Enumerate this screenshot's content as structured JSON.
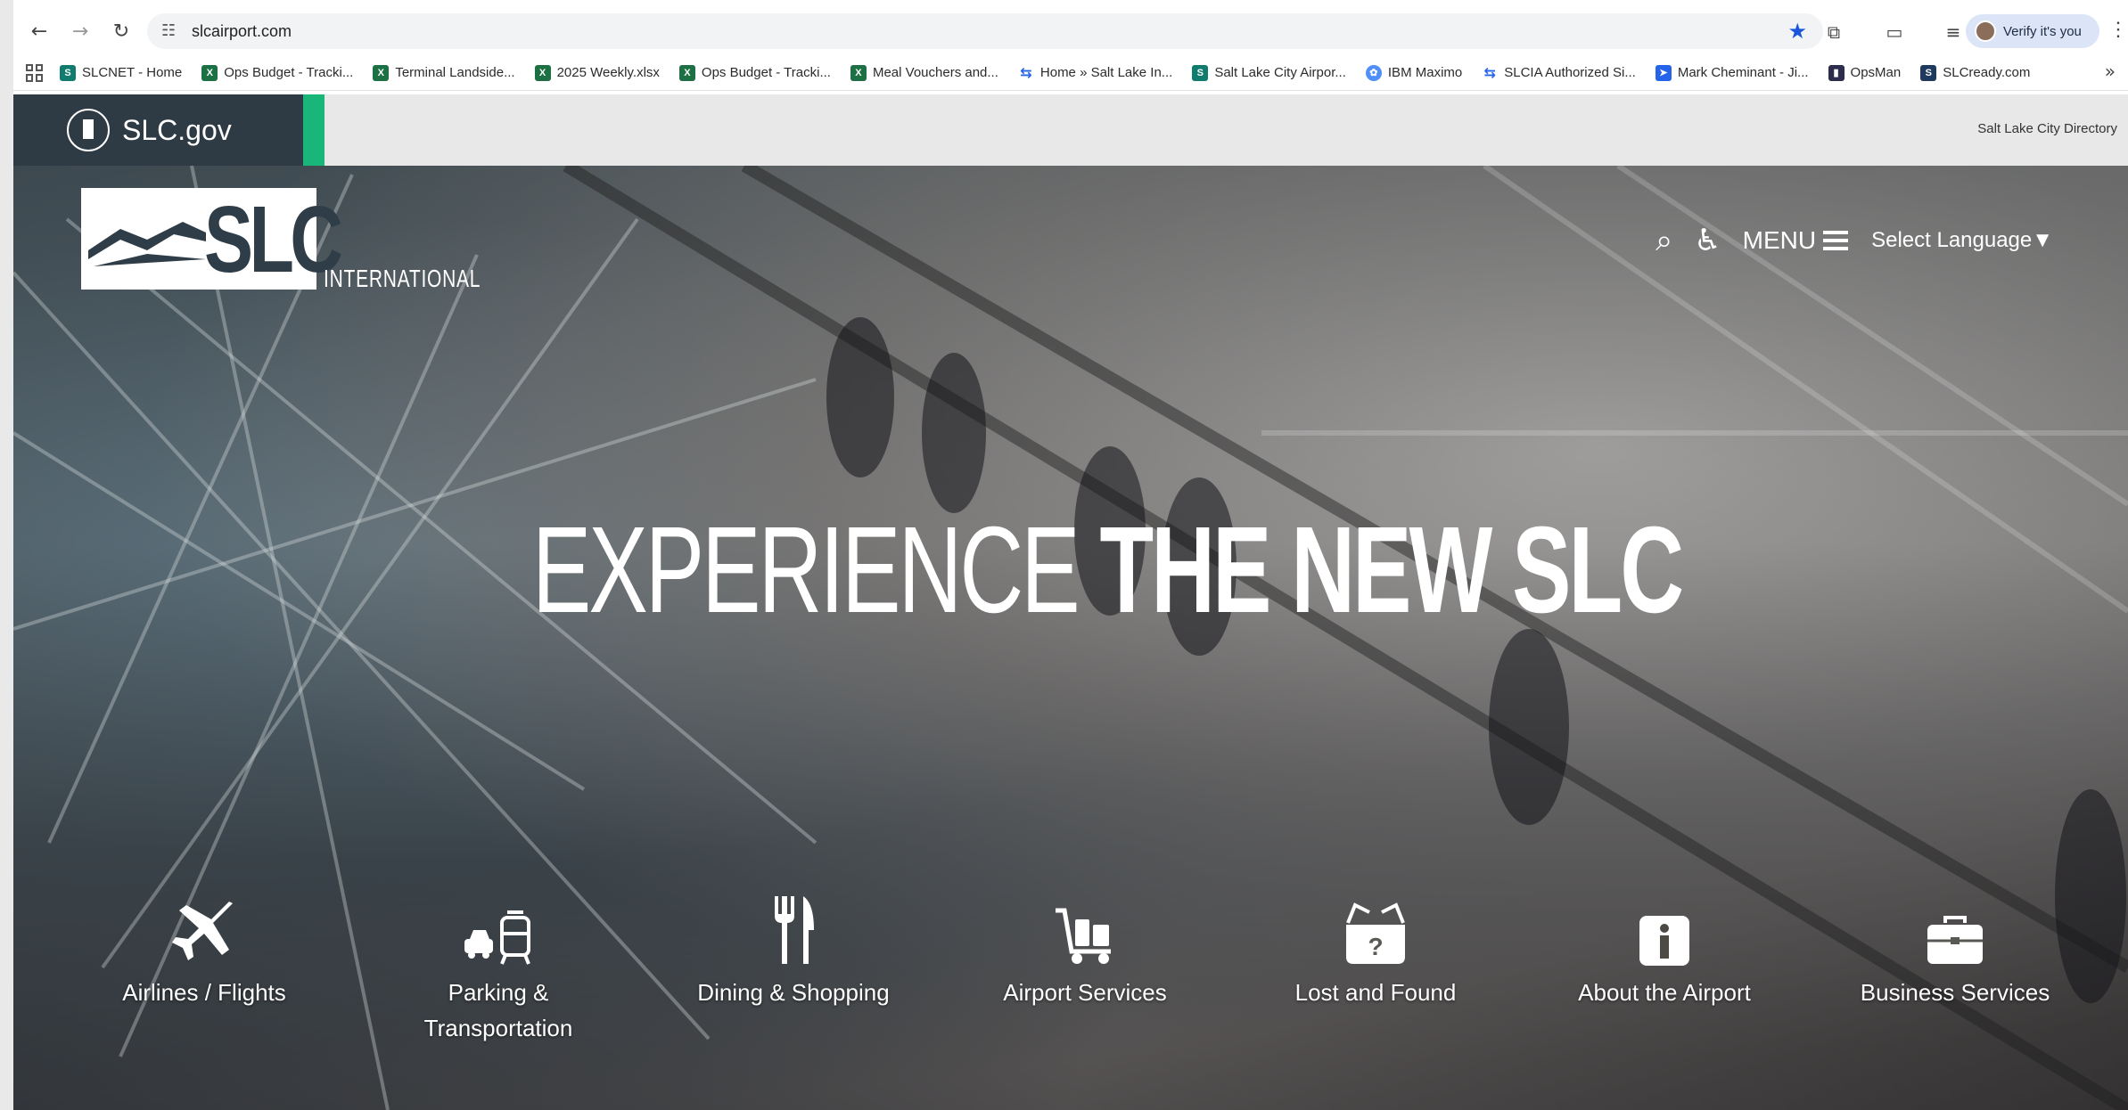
{
  "browser": {
    "url": "slcairport.com",
    "verify_label": "Verify it's you",
    "bookmarks": [
      {
        "label": "SLCNET - Home",
        "icon": "sharepoint-icon"
      },
      {
        "label": "Ops Budget - Tracki...",
        "icon": "excel-icon"
      },
      {
        "label": "Terminal Landside...",
        "icon": "excel-icon"
      },
      {
        "label": "2025 Weekly.xlsx",
        "icon": "excel-icon"
      },
      {
        "label": "Ops Budget - Tracki...",
        "icon": "excel-icon"
      },
      {
        "label": "Meal Vouchers and...",
        "icon": "excel-icon"
      },
      {
        "label": "Home » Salt Lake In...",
        "icon": "link-icon"
      },
      {
        "label": "Salt Lake City Airpor...",
        "icon": "sharepoint-icon"
      },
      {
        "label": "IBM Maximo",
        "icon": "ibm-icon"
      },
      {
        "label": "SLCIA Authorized Si...",
        "icon": "link-icon"
      },
      {
        "label": "Mark Cheminant - Ji...",
        "icon": "jira-icon"
      },
      {
        "label": "OpsMan",
        "icon": "opsman-icon"
      },
      {
        "label": "SLCready.com",
        "icon": "slcready-icon"
      }
    ]
  },
  "govbar": {
    "logo_text": "SLC.gov",
    "directory_link": "Salt Lake City Directory"
  },
  "site": {
    "logo_text": "SLC",
    "logo_subtext": "INTERNATIONAL",
    "menu_label": "MENU",
    "language_label": "Select Language▼",
    "headline_light": "EXPERIENCE ",
    "headline_bold": "THE NEW SLC",
    "quick_links": [
      {
        "label": "Airlines / Flights",
        "icon": "airplane-icon"
      },
      {
        "label": "Parking & Transportation",
        "icon": "car-tram-icon"
      },
      {
        "label": "Dining & Shopping",
        "icon": "fork-knife-icon"
      },
      {
        "label": "Airport Services",
        "icon": "baggage-cart-icon"
      },
      {
        "label": "Lost and Found",
        "icon": "lost-found-box-icon"
      },
      {
        "label": "About the Airport",
        "icon": "info-icon"
      },
      {
        "label": "Business Services",
        "icon": "briefcase-icon"
      }
    ]
  }
}
